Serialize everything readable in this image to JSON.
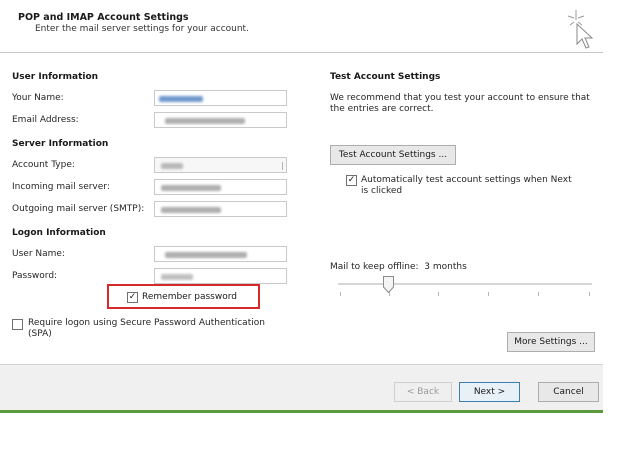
{
  "header": {
    "title": "POP and IMAP Account Settings",
    "subtitle": "Enter the mail server settings for your account.",
    "icon": "pointer-cursor-sparkle-icon"
  },
  "left": {
    "user_info_title": "User Information",
    "your_name_label": "Your Name:",
    "email_label": "Email Address:",
    "server_info_title": "Server Information",
    "account_type_label": "Account Type:",
    "incoming_label": "Incoming mail server:",
    "outgoing_label": "Outgoing mail server (SMTP):",
    "logon_info_title": "Logon Information",
    "user_name_label": "User Name:",
    "password_label": "Password:",
    "remember_password_label": "Remember password",
    "remember_password_checked": true,
    "spa_label_line1": "Require logon using Secure Password Authentication",
    "spa_label_line2": "(SPA)",
    "spa_checked": false
  },
  "right": {
    "test_title": "Test Account Settings",
    "test_desc_line1": "We recommend that you test your account to ensure that",
    "test_desc_line2": "the entries are correct.",
    "test_button": "Test Account Settings ...",
    "auto_test_line1": "Automatically test account settings when Next",
    "auto_test_line2": "is clicked",
    "auto_test_checked": true,
    "offline_label": "Mail to keep offline:",
    "offline_value": "3 months",
    "more_settings_button": "More Settings ..."
  },
  "footer": {
    "back_button": "< Back",
    "next_button": "Next >",
    "cancel_button": "Cancel"
  },
  "colors": {
    "highlight": "#d42a2a",
    "accent_rule": "#5b9a3c",
    "primary_border": "#3c7fb1"
  }
}
